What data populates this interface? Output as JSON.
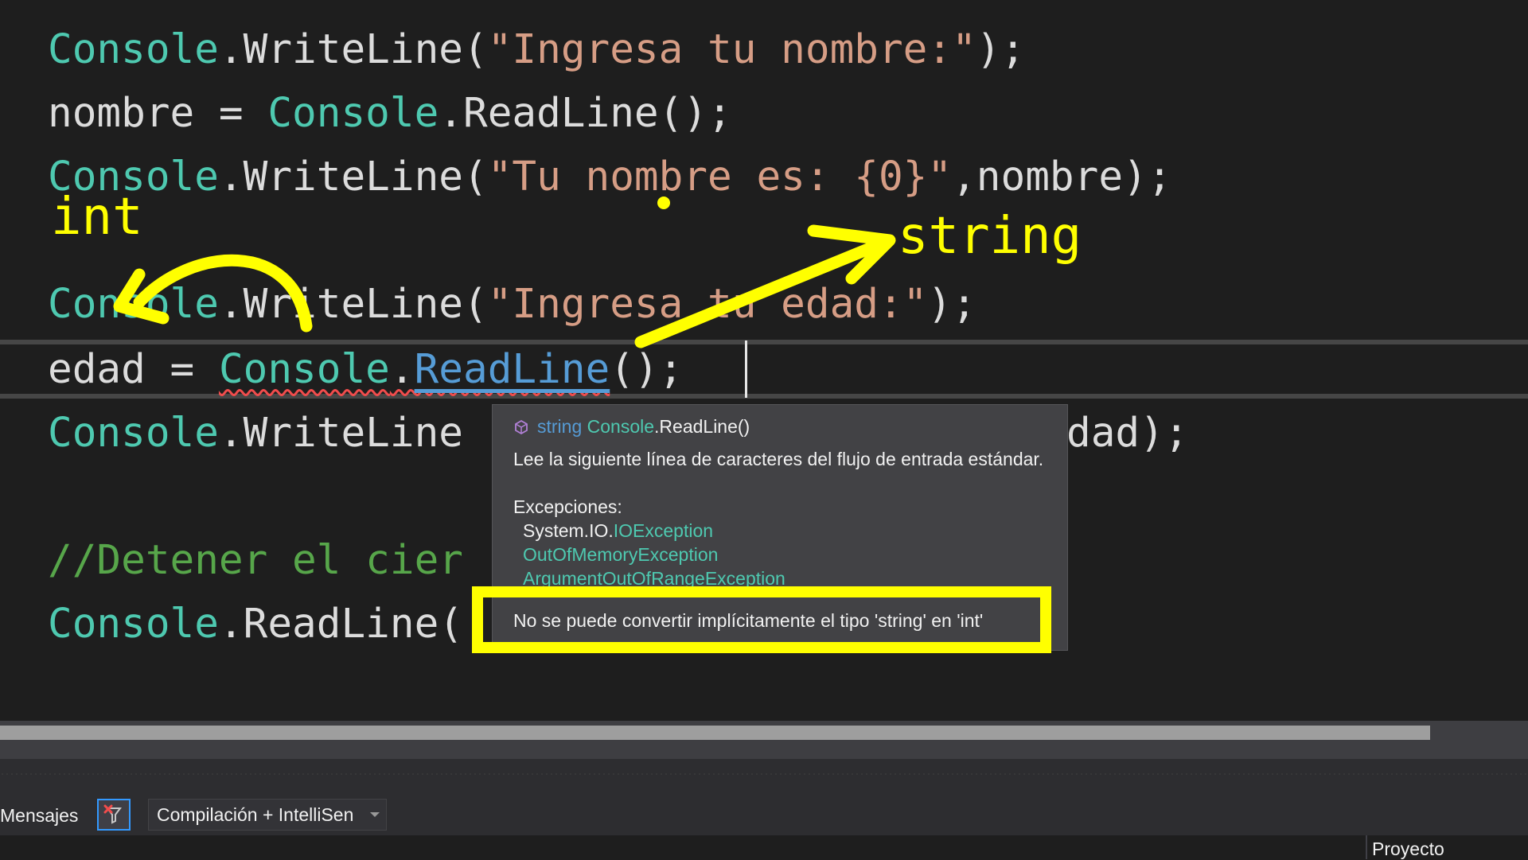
{
  "code": {
    "line1": {
      "cls": "Console",
      "method": ".WriteLine(",
      "str": "\"Ingresa tu nombre:\"",
      "end": ");"
    },
    "line2": {
      "pre": "nombre = ",
      "cls": "Console",
      "method": ".ReadLine();"
    },
    "line3": {
      "cls": "Console",
      "method": ".WriteLine(",
      "str": "\"Tu nombre es: {0}\"",
      "end": ",nombre);"
    },
    "line4": {
      "cls": "Console",
      "method": ".WriteLine(",
      "str": "\"Ingresa tu edad:\"",
      "end": ");"
    },
    "line5": {
      "pre": "edad = ",
      "cls": "Console",
      "dot": ".",
      "method": "ReadLine",
      "end": "();"
    },
    "line6": {
      "cls": "Console",
      "method": ".WriteLine",
      "tail": "dad);"
    },
    "line7": {
      "comment": "//Detener el cier"
    },
    "line8": {
      "cls": "Console",
      "method": ".ReadLine("
    }
  },
  "annotations": {
    "left_type": "int",
    "right_type": "string",
    "color": "#ffff00"
  },
  "tooltip": {
    "signature_type": "string",
    "signature_class": "Console",
    "signature_method": ".ReadLine()",
    "description": "Lee la siguiente línea de caracteres del flujo de entrada estándar.",
    "exceptions_header": "Excepciones:",
    "exceptions": [
      {
        "prefix": "System.IO.",
        "name": "IOException"
      },
      {
        "prefix": "",
        "name": "OutOfMemoryException"
      },
      {
        "prefix": "",
        "name": "ArgumentOutOfRangeException"
      }
    ],
    "error_message": "No se puede convertir implícitamente el tipo 'string' en 'int'"
  },
  "error_list": {
    "messages_label": "Mensajes",
    "filter_icon": "filter-clear-icon",
    "scope_dropdown": "Compilación + IntelliSen",
    "project_column": "Proyecto"
  },
  "colors": {
    "class": "#4ec9b0",
    "string": "#d69d85",
    "comment": "#57a64a",
    "error": "#f14c4c",
    "highlight": "#ffff00"
  }
}
